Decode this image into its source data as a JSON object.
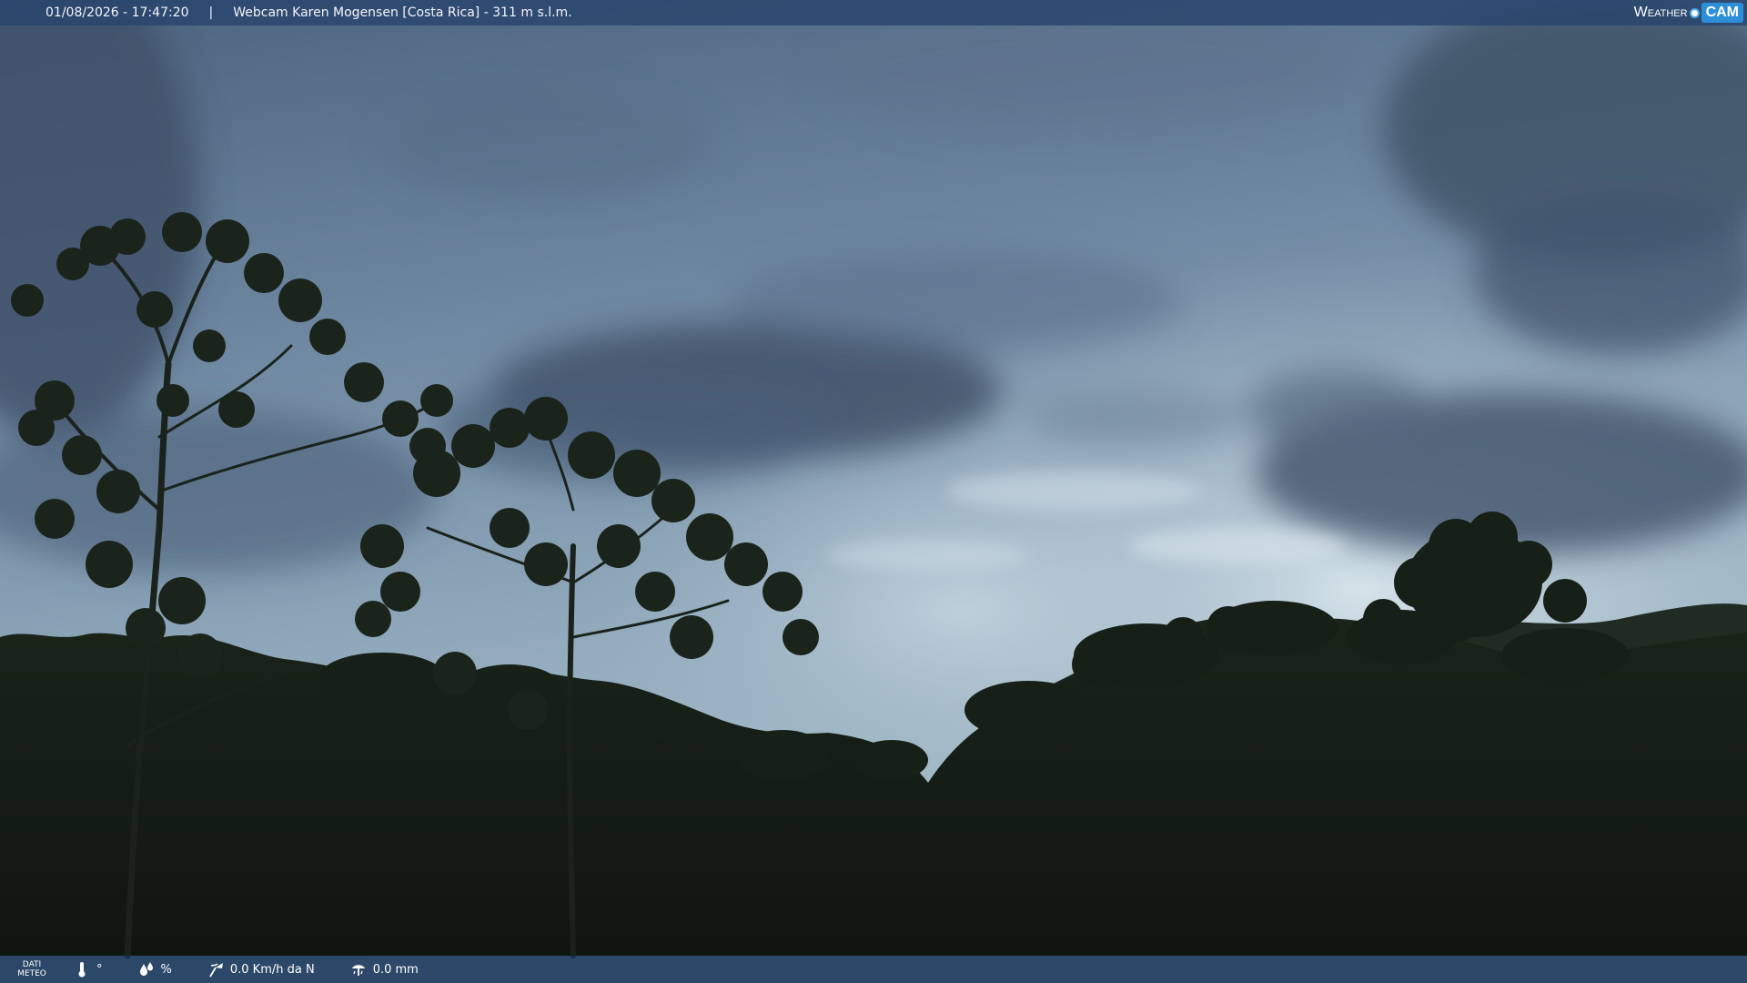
{
  "topbar": {
    "timestamp": "01/08/2026 - 17:47:20",
    "separator": "|",
    "title": "Webcam Karen Mogensen [Costa Rica]  - 311 m s.l.m."
  },
  "brand": {
    "word": "Weather",
    "cam": "CAM"
  },
  "bottombar": {
    "dati_line1": "DATI",
    "dati_line2": "METEO",
    "temperature": "°",
    "humidity": "%",
    "wind": "0.0 Km/h da N",
    "rain": "0.0 mm"
  },
  "colors": {
    "sky_top": "#4f6884",
    "sky_mid": "#7d96ad",
    "sky_light": "#c9d8e2",
    "cloud_dark": "#3b4f66",
    "forest": "#141d15",
    "bar_top": "#28446c",
    "bar_bottom": "#183458",
    "brand_blue": "#2c8fd8"
  }
}
